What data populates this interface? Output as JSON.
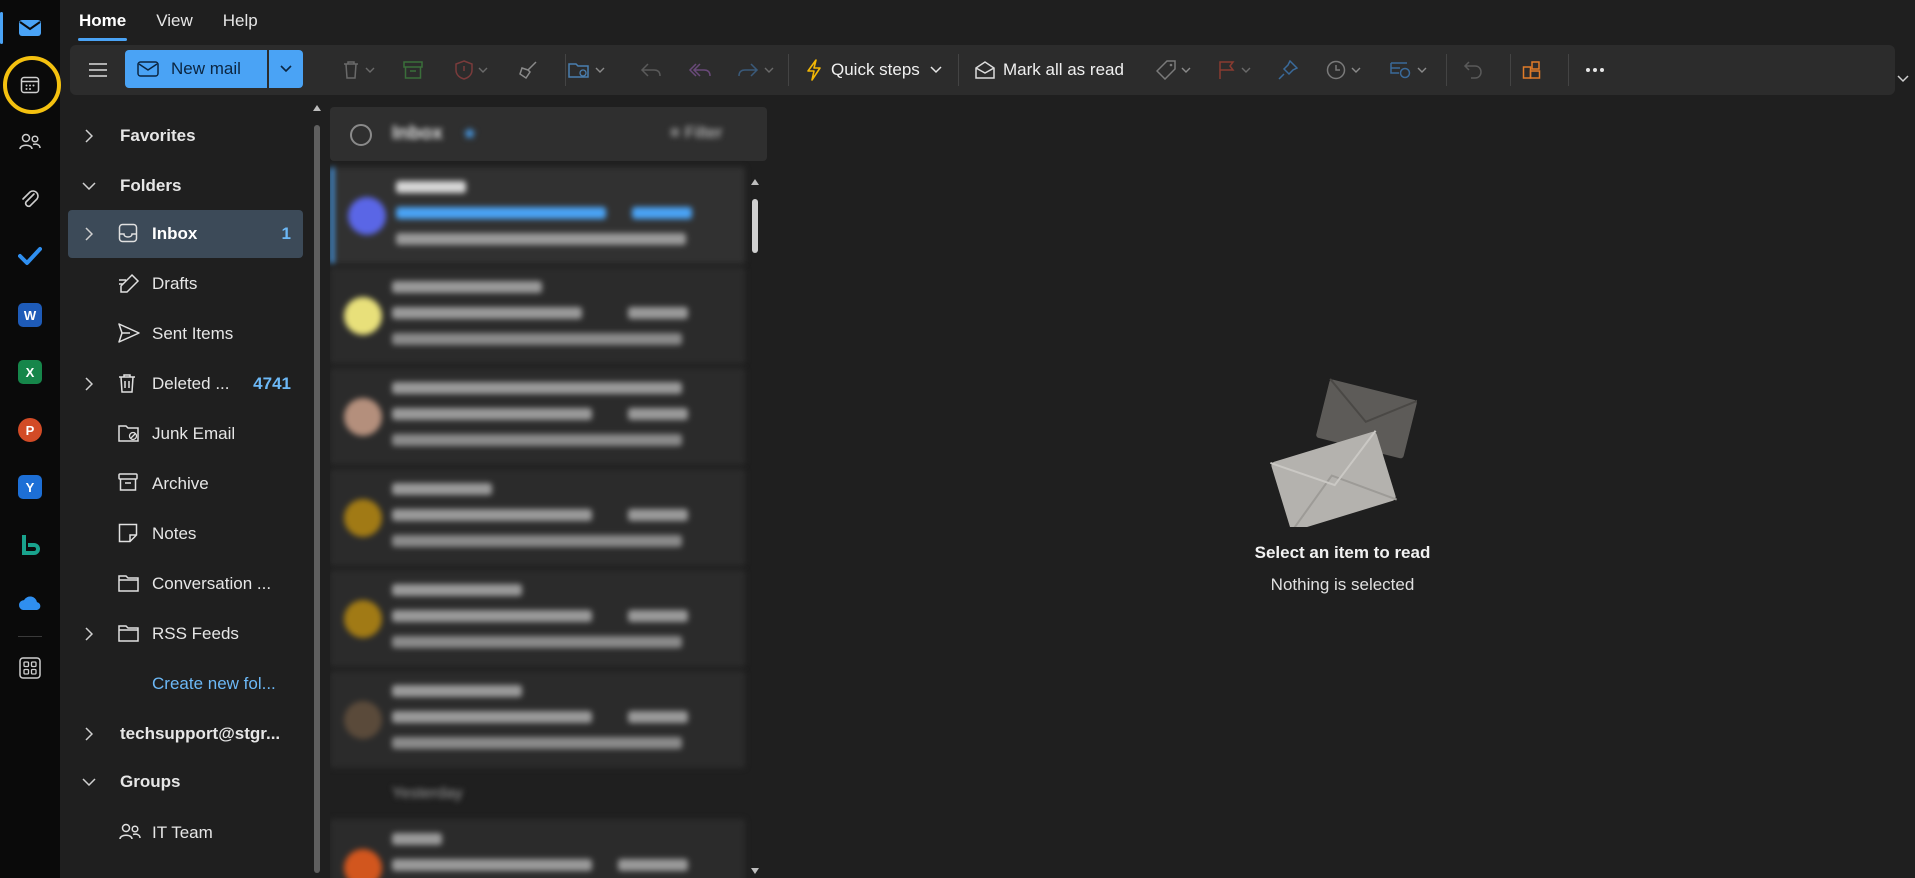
{
  "ribbon": {
    "tabs": [
      {
        "label": "Home",
        "active": true
      },
      {
        "label": "View",
        "active": false
      },
      {
        "label": "Help",
        "active": false
      }
    ]
  },
  "toolbar": {
    "new_mail_label": "New mail",
    "quick_steps_label": "Quick steps",
    "mark_all_read_label": "Mark all as read"
  },
  "folders": {
    "favorites": "Favorites",
    "folders_header": "Folders",
    "inbox": {
      "label": "Inbox",
      "count": "1"
    },
    "drafts": "Drafts",
    "sent": "Sent Items",
    "deleted": {
      "label": "Deleted ...",
      "count": "4741"
    },
    "junk": "Junk Email",
    "archive": "Archive",
    "notes": "Notes",
    "conversation": "Conversation ...",
    "rss": "RSS Feeds",
    "create_new": "Create new fol...",
    "account": "techsupport@stgr...",
    "groups_header": "Groups",
    "it_team": "IT Team"
  },
  "message_list": {
    "header_title": "Inbox",
    "filter_label": "Filter",
    "date_separator": "Yesterday"
  },
  "reading_pane": {
    "empty_title": "Select an item to read",
    "empty_subtitle": "Nothing is selected"
  },
  "colors": {
    "accent": "#4aa3f5",
    "highlight_ring": "#f4c10f",
    "background": "#1f1f1f",
    "rail": "#0a0a0a"
  }
}
